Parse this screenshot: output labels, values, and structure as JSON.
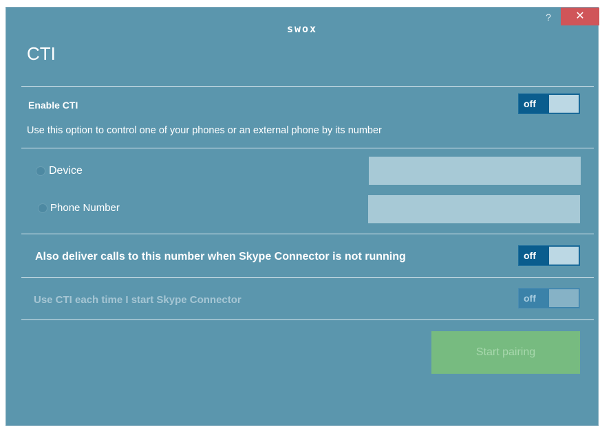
{
  "window": {
    "logo": "swox",
    "help_label": "?",
    "close_label": "✕"
  },
  "page": {
    "title": "CTI"
  },
  "enable_cti": {
    "label": "Enable CTI",
    "toggle": "off",
    "description": "Use this option to control one of your phones or an external phone by its number"
  },
  "options": {
    "device_label": "Device",
    "device_value": "",
    "phone_label": "Phone Number",
    "phone_value": ""
  },
  "deliver_calls": {
    "label": "Also deliver calls to this number when Skype Connector is not running",
    "toggle": "off"
  },
  "use_cti_on_start": {
    "label": "Use CTI each time I start Skype Connector",
    "toggle": "off"
  },
  "actions": {
    "start_pairing": "Start pairing"
  },
  "colors": {
    "background": "#5b96ad",
    "toggle_on_bg": "#0a5d8e",
    "close_red": "#d05559",
    "button_green": "#77bb80"
  }
}
